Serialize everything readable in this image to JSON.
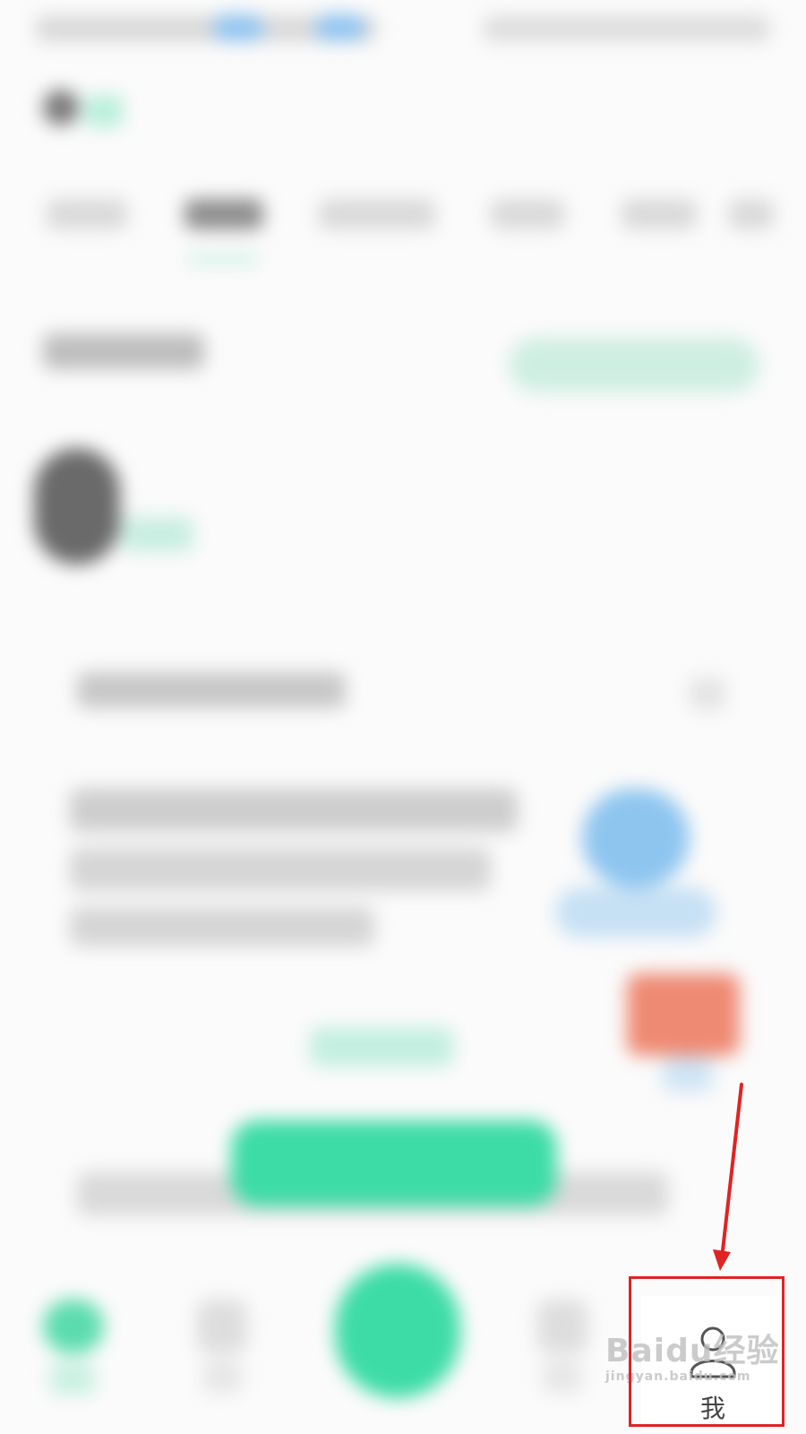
{
  "bottom_nav": {
    "me_label": "我"
  },
  "watermark": {
    "brand": "Baidu经验",
    "sub": "jingyan.baidu.com"
  },
  "icons": {
    "me": "person-icon"
  },
  "colors": {
    "accent_green": "#3ddca6",
    "annotation_red": "#e02323",
    "badge_orange": "#ee8a73",
    "blue": "#8ec5ef"
  }
}
